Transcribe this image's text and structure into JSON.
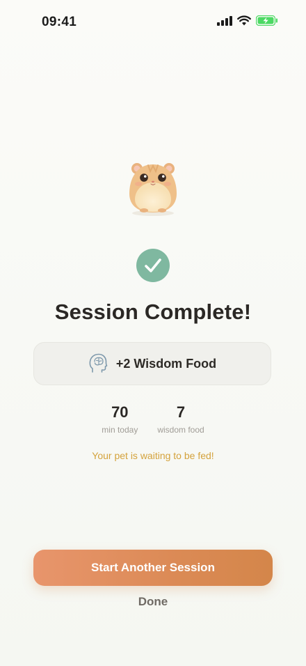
{
  "status_bar": {
    "time": "09:41",
    "icons": [
      "cellular-signal-icon",
      "wifi-icon",
      "battery-charging-icon"
    ],
    "battery_color": "#4cd964"
  },
  "pet": {
    "icon": "hamster-icon"
  },
  "completion": {
    "icon": "checkmark-icon",
    "badge_color": "#7fb8a0",
    "title": "Session Complete!"
  },
  "reward": {
    "icon": "brain-head-icon",
    "text": "+2 Wisdom Food"
  },
  "stats": [
    {
      "value": "70",
      "label": "min today"
    },
    {
      "value": "7",
      "label": "wisdom food"
    }
  ],
  "hint": "Your pet is waiting to be fed!",
  "actions": {
    "primary_label": "Start Another Session",
    "secondary_label": "Done",
    "accent_color": "#e08e5e"
  }
}
